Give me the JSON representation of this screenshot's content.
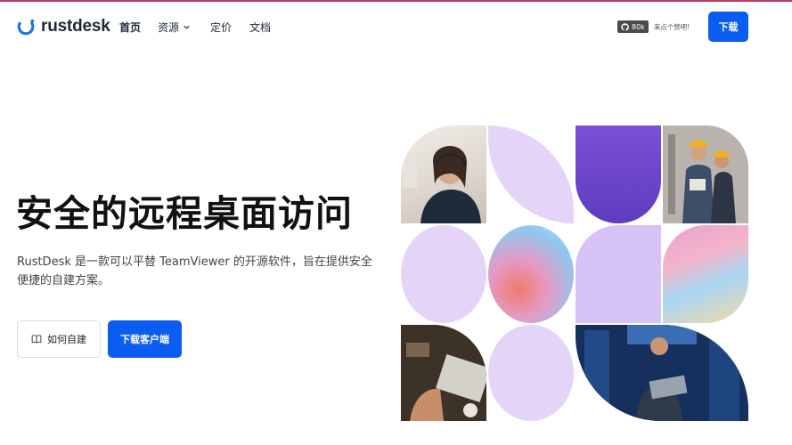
{
  "header": {
    "logo_text": "rustdesk",
    "nav": {
      "home": "首页",
      "resources": "资源",
      "pricing": "定价",
      "docs": "文档"
    },
    "github_stars": "80k",
    "github_text": "来点个赞吧!",
    "download_label": "下载"
  },
  "hero": {
    "title": "安全的远程桌面访问",
    "description": "RustDesk 是一款可以平替 TeamViewer 的开源软件，旨在提供安全便捷的自建方案。",
    "self_host_label": "如何自建",
    "download_client_label": "下载客户端"
  },
  "colors": {
    "brand_blue": "#0b5cf0",
    "lavender": "#e4d4f8",
    "purple": "#6a42c8"
  },
  "icons": {
    "logo": "rustdesk-logo-icon",
    "github": "github-icon",
    "chevron": "chevron-down-icon",
    "book": "book-icon"
  }
}
